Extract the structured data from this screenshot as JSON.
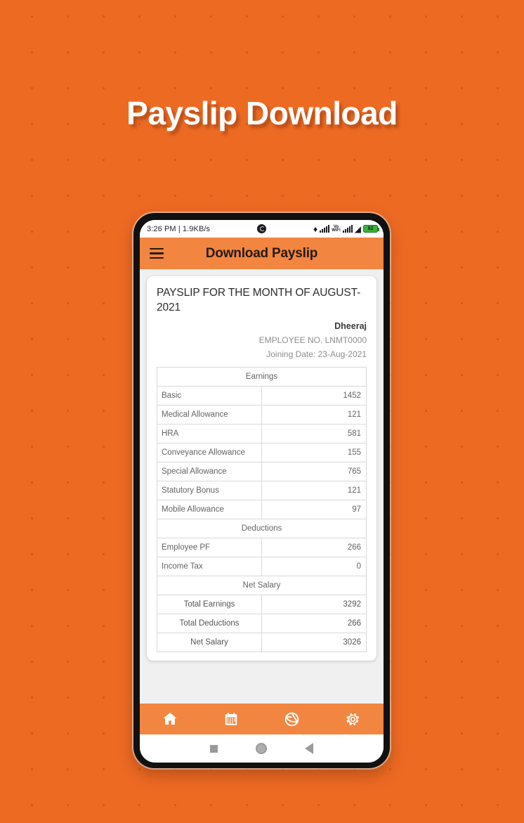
{
  "page": {
    "title": "Payslip Download",
    "background_color": "#ED6A23",
    "accent_color": "#F2853F"
  },
  "status_bar": {
    "time_and_speed": "3:26 PM | 1.9KB/s",
    "center_icon": "recording-dot-icon",
    "bluetooth_icon": "bluetooth-icon",
    "signal_icon": "signal-bars-icon",
    "vowifi_line1": "Vo",
    "vowifi_line2": "WiFi",
    "wifi_icon": "wifi-icon",
    "battery_level": "82"
  },
  "app_bar": {
    "menu_icon": "hamburger-menu-icon",
    "title": "Download Payslip"
  },
  "payslip": {
    "heading": "PAYSLIP FOR THE MONTH OF AUGUST-2021",
    "employee_name": "Dheeraj",
    "employee_no": "EMPLOYEE NO. LNMT0000",
    "joining_date": "Joining Date: 23-Aug-2021",
    "earnings_header": "Earnings",
    "earnings": [
      {
        "label": "Basic",
        "value": "1452"
      },
      {
        "label": "Medical Allowance",
        "value": "121"
      },
      {
        "label": "HRA",
        "value": "581"
      },
      {
        "label": "Conveyance Allowance",
        "value": "155"
      },
      {
        "label": "Special Allowance",
        "value": "765"
      },
      {
        "label": "Statutory Bonus",
        "value": "121"
      },
      {
        "label": "Mobile Allowance",
        "value": "97"
      }
    ],
    "deductions_header": "Deductions",
    "deductions": [
      {
        "label": "Employee PF",
        "value": "266"
      },
      {
        "label": "Income Tax",
        "value": "0"
      }
    ],
    "net_salary_header": "Net Salary",
    "totals": [
      {
        "label": "Total Earnings",
        "value": "3292"
      },
      {
        "label": "Total Deductions",
        "value": "266"
      },
      {
        "label": "Net Salary",
        "value": "3026"
      }
    ]
  },
  "bottom_nav": {
    "items": [
      {
        "icon": "home-icon"
      },
      {
        "icon": "calendar-icon"
      },
      {
        "icon": "aperture-icon"
      },
      {
        "icon": "gear-icon"
      }
    ]
  },
  "system_nav": {
    "recents_icon": "square-recents-icon",
    "home_icon": "circle-home-icon",
    "back_icon": "triangle-back-icon"
  }
}
